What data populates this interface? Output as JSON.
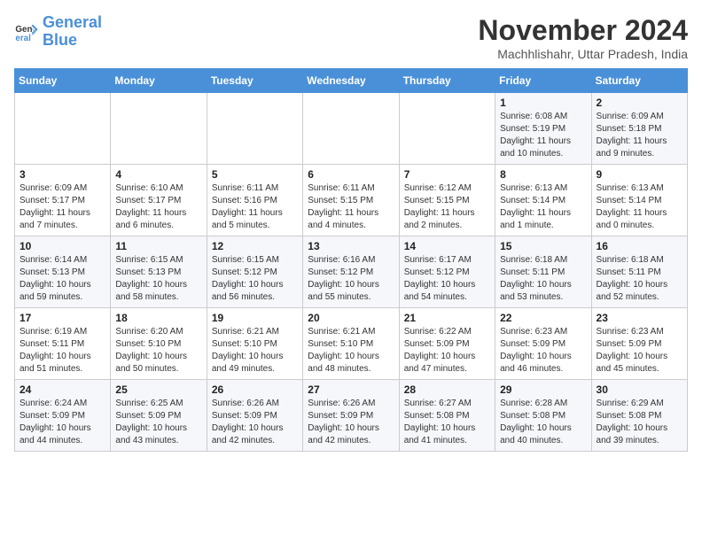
{
  "logo": {
    "line1": "General",
    "line2": "Blue"
  },
  "title": "November 2024",
  "location": "Machhlishahr, Uttar Pradesh, India",
  "days_of_week": [
    "Sunday",
    "Monday",
    "Tuesday",
    "Wednesday",
    "Thursday",
    "Friday",
    "Saturday"
  ],
  "weeks": [
    [
      {
        "num": "",
        "info": ""
      },
      {
        "num": "",
        "info": ""
      },
      {
        "num": "",
        "info": ""
      },
      {
        "num": "",
        "info": ""
      },
      {
        "num": "",
        "info": ""
      },
      {
        "num": "1",
        "info": "Sunrise: 6:08 AM\nSunset: 5:19 PM\nDaylight: 11 hours and 10 minutes."
      },
      {
        "num": "2",
        "info": "Sunrise: 6:09 AM\nSunset: 5:18 PM\nDaylight: 11 hours and 9 minutes."
      }
    ],
    [
      {
        "num": "3",
        "info": "Sunrise: 6:09 AM\nSunset: 5:17 PM\nDaylight: 11 hours and 7 minutes."
      },
      {
        "num": "4",
        "info": "Sunrise: 6:10 AM\nSunset: 5:17 PM\nDaylight: 11 hours and 6 minutes."
      },
      {
        "num": "5",
        "info": "Sunrise: 6:11 AM\nSunset: 5:16 PM\nDaylight: 11 hours and 5 minutes."
      },
      {
        "num": "6",
        "info": "Sunrise: 6:11 AM\nSunset: 5:15 PM\nDaylight: 11 hours and 4 minutes."
      },
      {
        "num": "7",
        "info": "Sunrise: 6:12 AM\nSunset: 5:15 PM\nDaylight: 11 hours and 2 minutes."
      },
      {
        "num": "8",
        "info": "Sunrise: 6:13 AM\nSunset: 5:14 PM\nDaylight: 11 hours and 1 minute."
      },
      {
        "num": "9",
        "info": "Sunrise: 6:13 AM\nSunset: 5:14 PM\nDaylight: 11 hours and 0 minutes."
      }
    ],
    [
      {
        "num": "10",
        "info": "Sunrise: 6:14 AM\nSunset: 5:13 PM\nDaylight: 10 hours and 59 minutes."
      },
      {
        "num": "11",
        "info": "Sunrise: 6:15 AM\nSunset: 5:13 PM\nDaylight: 10 hours and 58 minutes."
      },
      {
        "num": "12",
        "info": "Sunrise: 6:15 AM\nSunset: 5:12 PM\nDaylight: 10 hours and 56 minutes."
      },
      {
        "num": "13",
        "info": "Sunrise: 6:16 AM\nSunset: 5:12 PM\nDaylight: 10 hours and 55 minutes."
      },
      {
        "num": "14",
        "info": "Sunrise: 6:17 AM\nSunset: 5:12 PM\nDaylight: 10 hours and 54 minutes."
      },
      {
        "num": "15",
        "info": "Sunrise: 6:18 AM\nSunset: 5:11 PM\nDaylight: 10 hours and 53 minutes."
      },
      {
        "num": "16",
        "info": "Sunrise: 6:18 AM\nSunset: 5:11 PM\nDaylight: 10 hours and 52 minutes."
      }
    ],
    [
      {
        "num": "17",
        "info": "Sunrise: 6:19 AM\nSunset: 5:11 PM\nDaylight: 10 hours and 51 minutes."
      },
      {
        "num": "18",
        "info": "Sunrise: 6:20 AM\nSunset: 5:10 PM\nDaylight: 10 hours and 50 minutes."
      },
      {
        "num": "19",
        "info": "Sunrise: 6:21 AM\nSunset: 5:10 PM\nDaylight: 10 hours and 49 minutes."
      },
      {
        "num": "20",
        "info": "Sunrise: 6:21 AM\nSunset: 5:10 PM\nDaylight: 10 hours and 48 minutes."
      },
      {
        "num": "21",
        "info": "Sunrise: 6:22 AM\nSunset: 5:09 PM\nDaylight: 10 hours and 47 minutes."
      },
      {
        "num": "22",
        "info": "Sunrise: 6:23 AM\nSunset: 5:09 PM\nDaylight: 10 hours and 46 minutes."
      },
      {
        "num": "23",
        "info": "Sunrise: 6:23 AM\nSunset: 5:09 PM\nDaylight: 10 hours and 45 minutes."
      }
    ],
    [
      {
        "num": "24",
        "info": "Sunrise: 6:24 AM\nSunset: 5:09 PM\nDaylight: 10 hours and 44 minutes."
      },
      {
        "num": "25",
        "info": "Sunrise: 6:25 AM\nSunset: 5:09 PM\nDaylight: 10 hours and 43 minutes."
      },
      {
        "num": "26",
        "info": "Sunrise: 6:26 AM\nSunset: 5:09 PM\nDaylight: 10 hours and 42 minutes."
      },
      {
        "num": "27",
        "info": "Sunrise: 6:26 AM\nSunset: 5:09 PM\nDaylight: 10 hours and 42 minutes."
      },
      {
        "num": "28",
        "info": "Sunrise: 6:27 AM\nSunset: 5:08 PM\nDaylight: 10 hours and 41 minutes."
      },
      {
        "num": "29",
        "info": "Sunrise: 6:28 AM\nSunset: 5:08 PM\nDaylight: 10 hours and 40 minutes."
      },
      {
        "num": "30",
        "info": "Sunrise: 6:29 AM\nSunset: 5:08 PM\nDaylight: 10 hours and 39 minutes."
      }
    ]
  ]
}
